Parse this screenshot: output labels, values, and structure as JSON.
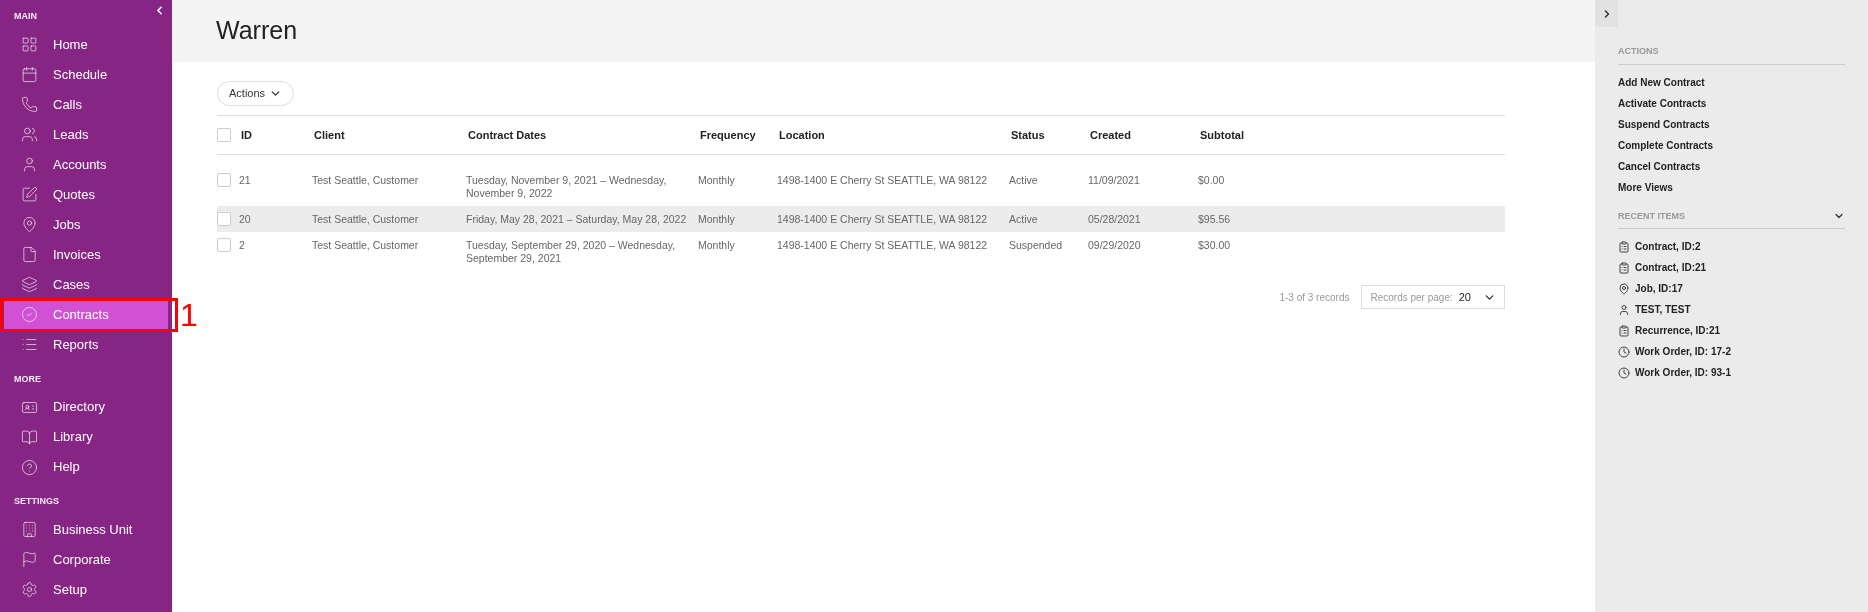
{
  "sidebar": {
    "sections": [
      {
        "title": "MAIN",
        "items": [
          {
            "label": "Home",
            "selected": false
          },
          {
            "label": "Schedule",
            "selected": false
          },
          {
            "label": "Calls",
            "selected": false
          },
          {
            "label": "Leads",
            "selected": false
          },
          {
            "label": "Accounts",
            "selected": false
          },
          {
            "label": "Quotes",
            "selected": false
          },
          {
            "label": "Jobs",
            "selected": false
          },
          {
            "label": "Invoices",
            "selected": false
          },
          {
            "label": "Cases",
            "selected": false
          },
          {
            "label": "Contracts",
            "selected": true
          },
          {
            "label": "Reports",
            "selected": false
          }
        ]
      },
      {
        "title": "MORE",
        "items": [
          {
            "label": "Directory",
            "selected": false
          },
          {
            "label": "Library",
            "selected": false
          },
          {
            "label": "Help",
            "selected": false
          }
        ]
      },
      {
        "title": "SETTINGS",
        "items": [
          {
            "label": "Business Unit",
            "selected": false
          },
          {
            "label": "Corporate",
            "selected": false
          },
          {
            "label": "Setup",
            "selected": false
          }
        ]
      }
    ]
  },
  "annotation": {
    "label": "1"
  },
  "page": {
    "title": "Warren"
  },
  "actions_button": "Actions",
  "table": {
    "all_checked": false,
    "columns": [
      "ID",
      "Client",
      "Contract Dates",
      "Frequency",
      "Location",
      "Status",
      "Created",
      "Subtotal"
    ],
    "rows": [
      {
        "checked": false,
        "highlighted": false,
        "cells": [
          "21",
          "Test Seattle, Customer",
          "Tuesday, November 9, 2021 – Wednesday, November 9, 2022",
          "Monthly",
          "1498-1400 E Cherry St SEATTLE, WA 98122",
          "Active",
          "11/09/2021",
          "$0.00"
        ]
      },
      {
        "checked": false,
        "highlighted": true,
        "cells": [
          "20",
          "Test Seattle, Customer",
          "Friday, May 28, 2021 – Saturday, May 28, 2022",
          "Monthly",
          "1498-1400 E Cherry St SEATTLE, WA 98122",
          "Active",
          "05/28/2021",
          "$95.56"
        ]
      },
      {
        "checked": false,
        "highlighted": false,
        "cells": [
          "2",
          "Test Seattle, Customer",
          "Tuesday, September 29, 2020 – Wednesday, September 29, 2021",
          "Monthly",
          "1498-1400 E Cherry St SEATTLE, WA 98122",
          "Suspended",
          "09/29/2020",
          "$30.00"
        ]
      }
    ]
  },
  "pagination": {
    "summary": "1-3 of 3 records",
    "per_page_label": "Records per page:",
    "per_page_value": "20"
  },
  "right_panel": {
    "actions_title": "ACTIONS",
    "actions": [
      "Add New Contract",
      "Activate Contracts",
      "Suspend Contracts",
      "Complete Contracts",
      "Cancel Contracts",
      "More Views"
    ],
    "recent_title": "RECENT ITEMS",
    "recent_items": [
      {
        "kind": "contract",
        "label": "Contract, ID:2"
      },
      {
        "kind": "contract",
        "label": "Contract, ID:21"
      },
      {
        "kind": "job",
        "label": "Job, ID:17"
      },
      {
        "kind": "person",
        "label": "TEST, TEST"
      },
      {
        "kind": "contract",
        "label": "Recurrence, ID:21"
      },
      {
        "kind": "workorder",
        "label": "Work Order, ID: 17-2"
      },
      {
        "kind": "workorder",
        "label": "Work Order, ID: 93-1"
      }
    ]
  }
}
